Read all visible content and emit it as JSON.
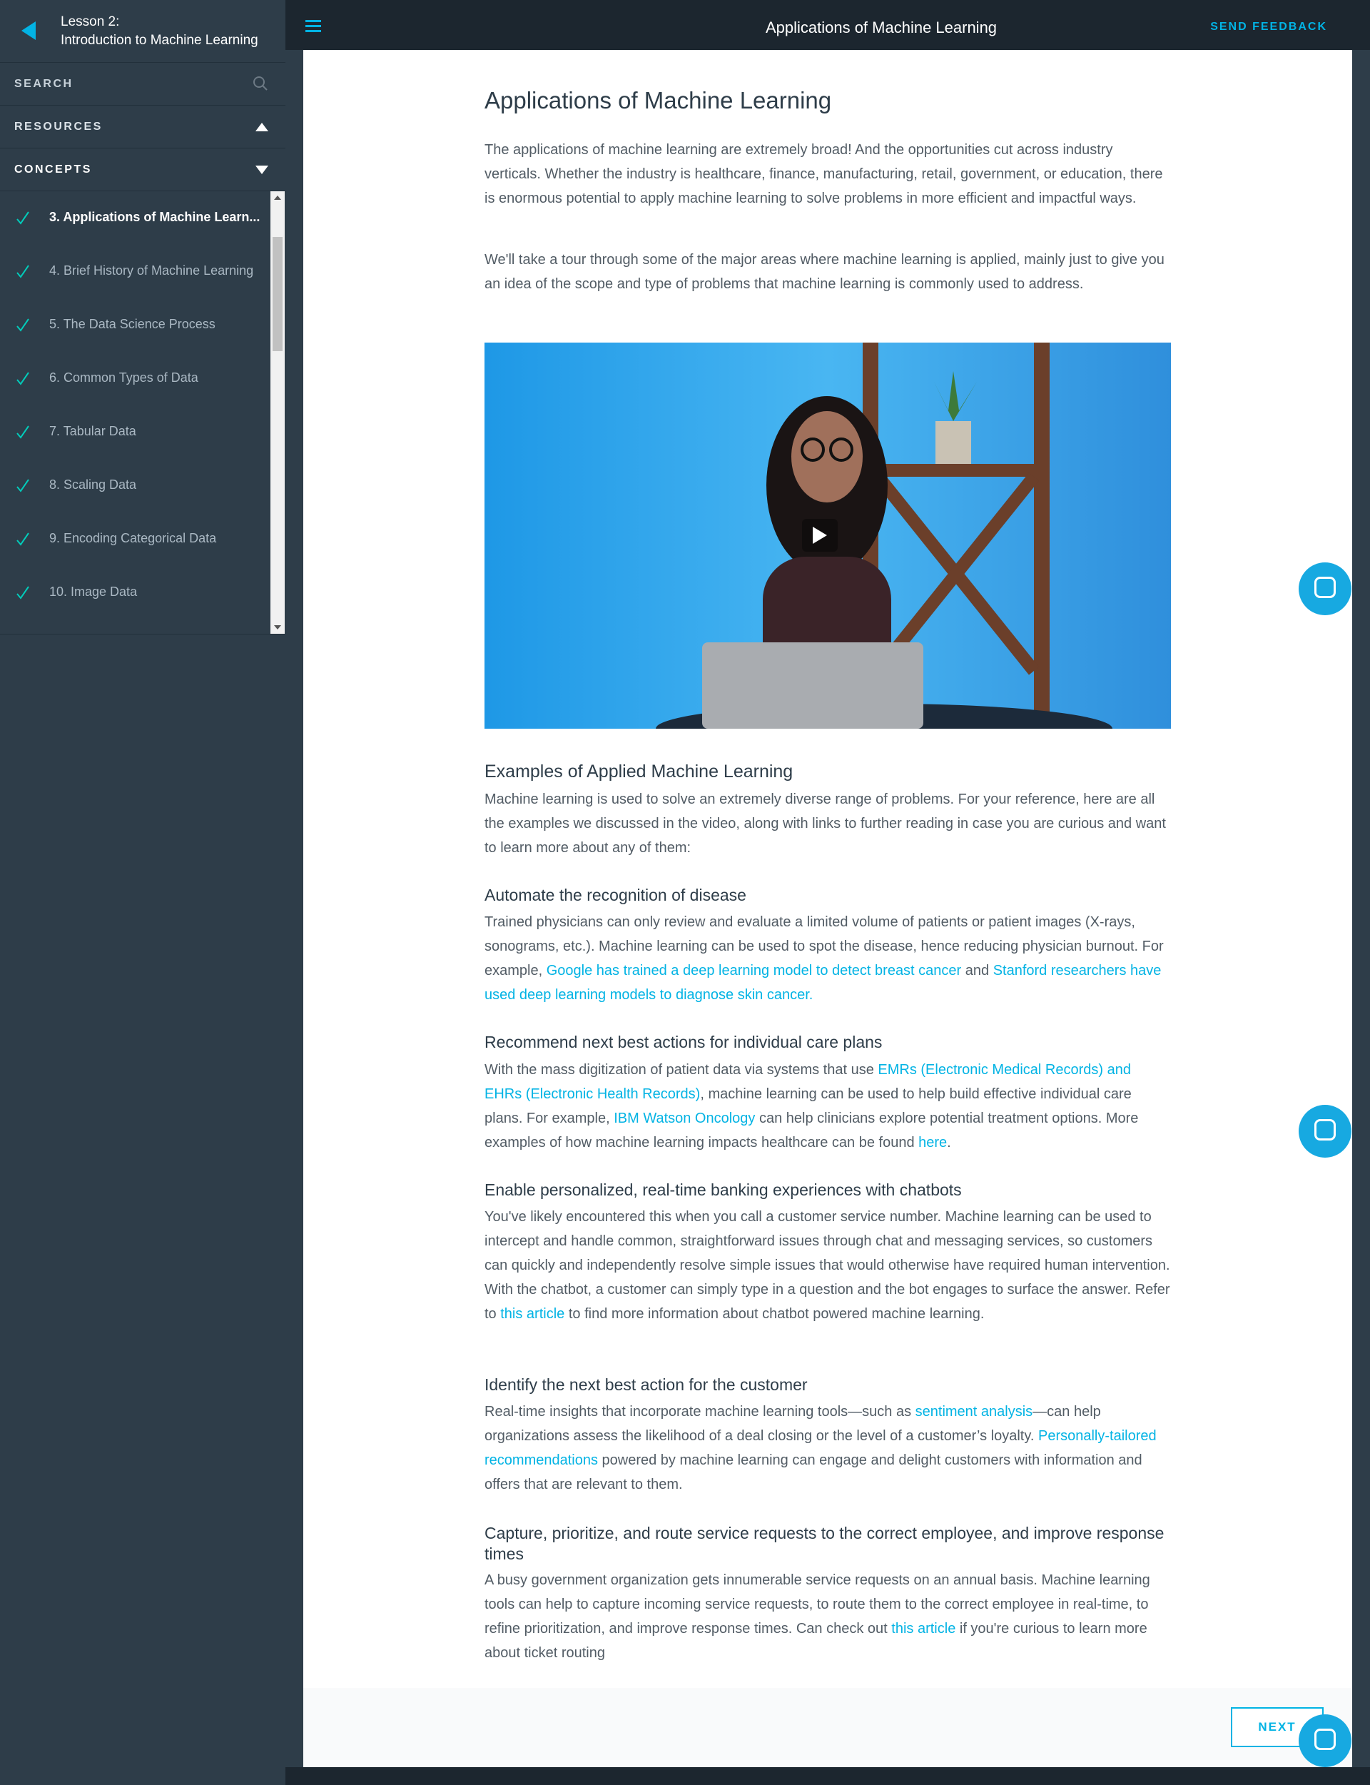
{
  "sidebar": {
    "lesson_number": "Lesson 2:",
    "lesson_title": "Introduction to Machine Learning",
    "search_label": "SEARCH",
    "resources_label": "RESOURCES",
    "concepts_label": "CONCEPTS",
    "concepts": [
      {
        "label": "3. Applications of Machine Learn...",
        "active": true
      },
      {
        "label": "4. Brief History of Machine Learning"
      },
      {
        "label": "5. The Data Science Process"
      },
      {
        "label": "6. Common Types of Data"
      },
      {
        "label": "7. Tabular Data"
      },
      {
        "label": "8. Scaling Data"
      },
      {
        "label": "9. Encoding Categorical Data"
      },
      {
        "label": "10. Image Data"
      }
    ]
  },
  "topbar": {
    "title": "Applications of Machine Learning",
    "feedback": "SEND FEEDBACK"
  },
  "content": {
    "title": "Applications of Machine Learning",
    "intro1": "The applications of machine learning are extremely broad! And the opportunities cut across industry verticals. Whether the industry is healthcare, finance, manufacturing, retail, government, or education, there is enormous potential to apply machine learning to solve problems in more efficient and impactful ways.",
    "intro2": "We'll take a tour through some of the major areas where machine learning is applied, mainly just to give you an idea of the scope and type of problems that machine learning is commonly used to address.",
    "examples_heading": "Examples of Applied Machine Learning",
    "examples_text": "Machine learning is used to solve an extremely diverse range of problems. For your reference, here are all the examples we discussed in the video, along with links to further reading in case you are curious and want to learn more about any of them:",
    "s1_heading": "Automate the recognition of disease",
    "s1_text_a": "Trained physicians can only review and evaluate a limited volume of patients or patient images (X-rays, sonograms, etc.). Machine learning can be used to spot the disease, hence reducing physician burnout. For example, ",
    "s1_link1": "Google has trained a deep learning model to detect breast cancer",
    "s1_text_b": " and ",
    "s1_link2": "Stanford researchers have used deep learning models to diagnose skin cancer.",
    "s2_heading": "Recommend next best actions for individual care plans",
    "s2_text_a": "With the mass digitization of patient data via systems that use ",
    "s2_link1": "EMRs (Electronic Medical Records) and EHRs (Electronic Health Records)",
    "s2_text_b": ", machine learning can be used to help build effective individual care plans. For example, ",
    "s2_link2": "IBM Watson Oncology",
    "s2_text_c": " can help clinicians explore potential treatment options. More examples of how machine learning impacts healthcare can be found ",
    "s2_link3": "here",
    "s2_text_d": ".",
    "s3_heading": "Enable personalized, real-time banking experiences with chatbots",
    "s3_text_a": "You've likely encountered this when you call a customer service number. Machine learning can be used to intercept and handle common, straightforward issues through chat and messaging services, so customers can quickly and independently resolve simple issues that would otherwise have required human intervention. With the chatbot, a customer can simply type in a question and the bot engages to surface the answer. Refer to ",
    "s3_link1": "this article",
    "s3_text_b": " to find more information about chatbot powered machine learning.",
    "s4_heading": "Identify the next best action for the customer",
    "s4_text_a": "Real-time insights that incorporate machine learning tools—such as ",
    "s4_link1": "sentiment analysis",
    "s4_text_b": "—can help organizations assess the likelihood of a deal closing or the level of a customer’s loyalty. ",
    "s4_link2": "Personally-tailored recommendations",
    "s4_text_c": " powered by machine learning can engage and delight customers with information and offers that are relevant to them.",
    "s5_heading": "Capture, prioritize, and route service requests to the correct employee, and improve response times",
    "s5_text_a": "A busy government organization gets innumerable service requests on an annual basis. Machine learning tools can help to capture incoming service requests, to route them to the correct employee in real-time, to refine prioritization, and improve response times. Can check out ",
    "s5_link1": "this article",
    "s5_text_b": " if you're curious to learn more about ticket routing"
  },
  "next_label": "NEXT",
  "colors": {
    "accent": "#02b3e4",
    "sidebar": "#2e3d49",
    "topbar": "#1c262f",
    "check": "#02ccba"
  }
}
